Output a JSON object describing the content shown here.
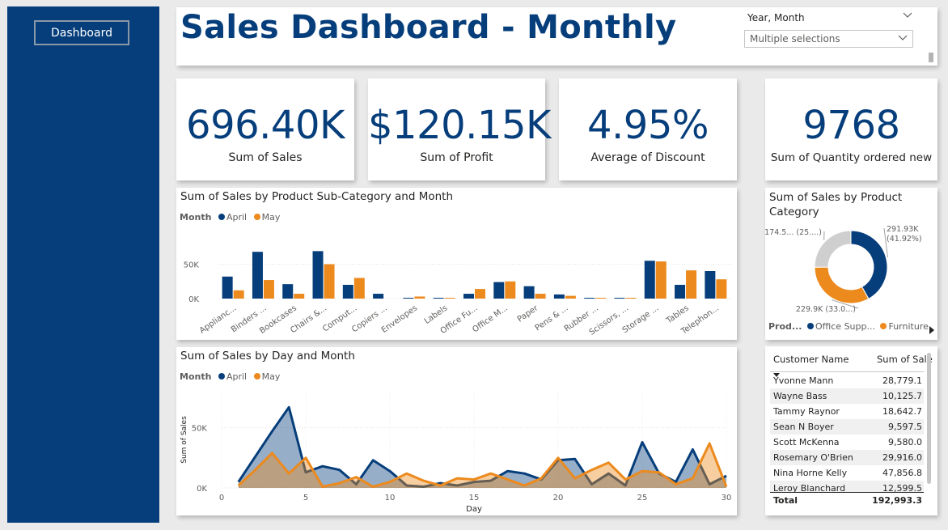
{
  "nav": {
    "dashboard_label": "Dashboard"
  },
  "header": {
    "title": "Sales Dashboard - Monthly"
  },
  "slicer": {
    "label": "Year, Month",
    "value": "Multiple selections"
  },
  "kpis": [
    {
      "value": "696.40K",
      "label": "Sum of Sales"
    },
    {
      "value": "$120.15K",
      "label": "Sum of Profit"
    },
    {
      "value": "4.95%",
      "label": "Average of Discount"
    },
    {
      "value": "9768",
      "label": "Sum of Quantity ordered new"
    }
  ],
  "colors": {
    "april": "#063e7b",
    "may": "#ec8a1d",
    "third": "#cfcfcf",
    "sidebar": "#063e7b"
  },
  "chart_data": [
    {
      "type": "bar",
      "title": "Sum of Sales by Product Sub-Category and Month",
      "legend_title": "Month",
      "legend_position": "top-left",
      "categories": [
        "Applianc...",
        "Binders ...",
        "Bookcases",
        "Chairs &...",
        "Comput...",
        "Copiers ...",
        "Envelopes",
        "Labels",
        "Office Fu...",
        "Office M...",
        "Paper",
        "Pens & ...",
        "Rubber ...",
        "Scissors, ...",
        "Storage ...",
        "Tables",
        "Telephon..."
      ],
      "series": [
        {
          "name": "April",
          "values": [
            32000,
            68000,
            21000,
            69000,
            20000,
            7000,
            1000,
            1000,
            7000,
            24000,
            18000,
            6000,
            1000,
            1000,
            55000,
            20000,
            40000
          ]
        },
        {
          "name": "May",
          "values": [
            12000,
            27000,
            7000,
            50000,
            30000,
            0,
            3000,
            1000,
            14000,
            25000,
            7000,
            4000,
            1000,
            1000,
            54000,
            41000,
            28000
          ]
        }
      ],
      "yticks": [
        "0K",
        "50K"
      ],
      "ylim": [
        0,
        100000
      ],
      "grid": true
    },
    {
      "type": "area",
      "title": "Sum of Sales by Day and Month",
      "legend_title": "Month",
      "legend_position": "top-left",
      "xlabel": "Day",
      "ylabel": "Sum of Sales",
      "xticks": [
        "0",
        "5",
        "10",
        "15",
        "20",
        "25",
        "30"
      ],
      "yticks": [
        "0K",
        "50K"
      ],
      "xlim": [
        0,
        30
      ],
      "ylim": [
        0,
        80000
      ],
      "grid": true,
      "x": [
        1,
        2,
        3,
        4,
        5,
        6,
        7,
        8,
        9,
        10,
        11,
        12,
        13,
        14,
        15,
        16,
        17,
        18,
        19,
        20,
        21,
        22,
        23,
        24,
        25,
        26,
        27,
        28,
        29,
        30
      ],
      "series": [
        {
          "name": "April",
          "values": [
            5000,
            26000,
            47000,
            67000,
            13000,
            18000,
            15000,
            3000,
            23000,
            14000,
            2000,
            1000,
            4000,
            2000,
            5000,
            6000,
            14000,
            12000,
            7000,
            23000,
            24000,
            3000,
            12000,
            2000,
            38000,
            12000,
            5000,
            32000,
            3000,
            10000
          ]
        },
        {
          "name": "May",
          "values": [
            2000,
            15000,
            29000,
            12000,
            25000,
            1000,
            4000,
            9000,
            1000,
            5000,
            12000,
            6000,
            2000,
            8000,
            7000,
            12000,
            7000,
            2000,
            8000,
            25000,
            8000,
            15000,
            21000,
            7000,
            14000,
            13000,
            3000,
            8000,
            37000,
            1000
          ]
        }
      ]
    },
    {
      "type": "pie",
      "donut": true,
      "title": "Sum of Sales by Product Category",
      "legend_title": "Prod...",
      "legend_position": "bottom",
      "legend_items": [
        "Office Supp...",
        "Furniture"
      ],
      "slices": [
        {
          "name": "Office Supp...",
          "value": 291930,
          "label": "291.93K\n(41.92%)"
        },
        {
          "name": "Furniture",
          "value": 229900,
          "label": "229.9K (33.0...)"
        },
        {
          "name": "Technology",
          "value": 174570,
          "label": "174.5... (25....)"
        }
      ]
    }
  ],
  "table": {
    "headers": [
      "Customer Name",
      "Sum of Sale"
    ],
    "rows": [
      {
        "name": "Yvonne Mann",
        "value": "28,779.1"
      },
      {
        "name": "Wayne Bass",
        "value": "10,125.7"
      },
      {
        "name": "Tammy Raynor",
        "value": "18,642.7"
      },
      {
        "name": "Sean N Boyer",
        "value": "9,597.5"
      },
      {
        "name": "Scott McKenna",
        "value": "9,580.0"
      },
      {
        "name": "Rosemary O'Brien",
        "value": "29,916.0"
      },
      {
        "name": "Nina Horne Kelly",
        "value": "47,856.8"
      },
      {
        "name": "Leroy Blanchard",
        "value": "12,599.5"
      }
    ],
    "total_label": "Total",
    "total_value": "192,993.3"
  }
}
